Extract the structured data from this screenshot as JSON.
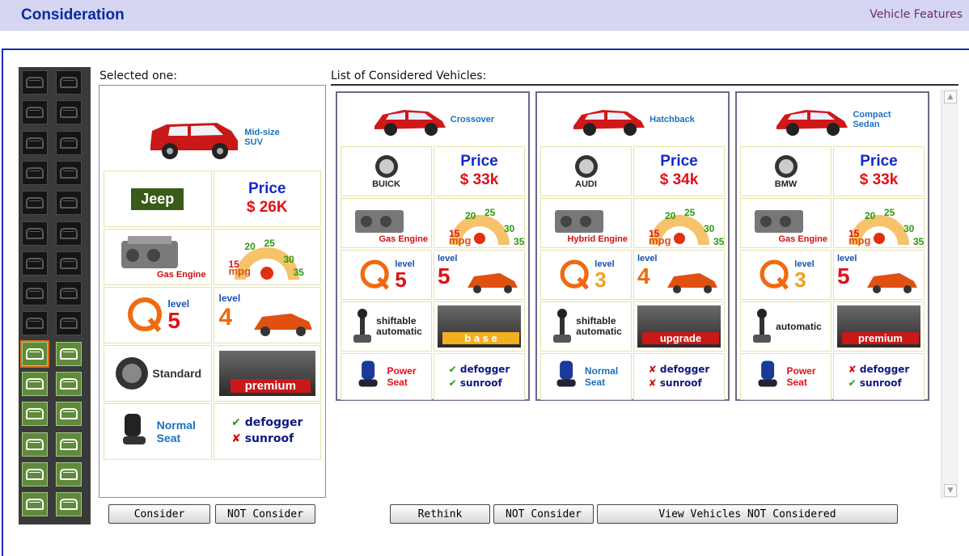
{
  "header": {
    "title": "Consideration",
    "link": "Vehicle Features"
  },
  "labels": {
    "selected": "Selected one:",
    "list": "List of Considered Vehicles:"
  },
  "selected": {
    "type_line1": "Mid-size",
    "type_line2": "SUV",
    "brand": "Jeep",
    "price_label": "Price",
    "price": "$ 26K",
    "engine": "Gas Engine",
    "mpg": {
      "label": "mpg",
      "ticks": [
        "15",
        "20",
        "25",
        "30",
        "35"
      ]
    },
    "quality": {
      "word": "level",
      "value": "5"
    },
    "safety": {
      "word": "level",
      "value": "4"
    },
    "transmission": "Standard",
    "trim": "premium",
    "seat_line1": "Normal",
    "seat_line2": "Seat",
    "features": [
      {
        "mark": "✔",
        "text": "defogger"
      },
      {
        "mark": "✘",
        "text": "sunroof"
      }
    ]
  },
  "vehicles": [
    {
      "type": "Crossover",
      "type2": "",
      "brand": "BUICK",
      "price_label": "Price",
      "price": "$ 33k",
      "engine": "Gas Engine",
      "mpg_ticks": [
        "15",
        "20",
        "25",
        "30",
        "35"
      ],
      "mpg_label": "mpg",
      "quality": "5",
      "safety": "5",
      "level_word": "level",
      "transmission_line1": "shiftable",
      "transmission_line2": "automatic",
      "trim": "b a s e",
      "seat_line1": "Power",
      "seat_line2": "Seat",
      "features": [
        {
          "mark": "✔",
          "text": "defogger"
        },
        {
          "mark": "✔",
          "text": "sunroof"
        }
      ]
    },
    {
      "type": "Hatchback",
      "type2": "",
      "brand": "AUDI",
      "price_label": "Price",
      "price": "$ 34k",
      "engine": "Hybrid Engine",
      "mpg_ticks": [
        "15",
        "20",
        "25",
        "30",
        "35"
      ],
      "mpg_label": "mpg",
      "quality": "3",
      "safety": "4",
      "level_word": "level",
      "transmission_line1": "shiftable",
      "transmission_line2": "automatic",
      "trim": "upgrade",
      "seat_line1": "Normal",
      "seat_line2": "Seat",
      "features": [
        {
          "mark": "✘",
          "text": "defogger"
        },
        {
          "mark": "✘",
          "text": "sunroof"
        }
      ]
    },
    {
      "type": "Compact",
      "type2": "Sedan",
      "brand": "BMW",
      "price_label": "Price",
      "price": "$ 33k",
      "engine": "Gas Engine",
      "mpg_ticks": [
        "15",
        "20",
        "25",
        "30",
        "35"
      ],
      "mpg_label": "mpg",
      "quality": "3",
      "safety": "5",
      "level_word": "level",
      "transmission_line1": "automatic",
      "transmission_line2": "",
      "trim": "premium",
      "seat_line1": "Power",
      "seat_line2": "Seat",
      "features": [
        {
          "mark": "✘",
          "text": "defogger"
        },
        {
          "mark": "✔",
          "text": "sunroof"
        }
      ]
    }
  ],
  "buttons": {
    "consider": "Consider",
    "not_consider_left": "NOT Consider",
    "rethink": "Rethink",
    "not_consider_right": "NOT Consider",
    "view_not_considered": "View Vehicles NOT Considered"
  },
  "colors": {
    "header_bg": "#d6d6f2",
    "title": "#0a2a9c",
    "frame": "#1a2bb0",
    "price_label": "#1628c8",
    "price_value": "#e0101a",
    "slot_active": "#5f8a3a",
    "slot_selected_outline": "#e06a10"
  },
  "strip": {
    "active_slots_from_row": 9,
    "rows": 15,
    "selected_row": 9
  }
}
